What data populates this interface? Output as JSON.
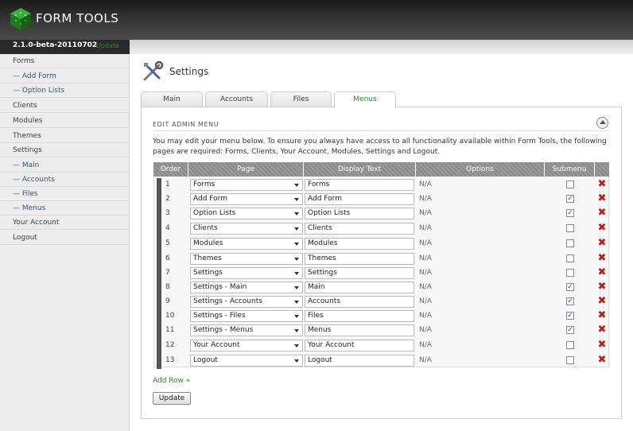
{
  "app": {
    "title": "FORM TOOLS",
    "version": "2.1.0-beta-20110702",
    "update_label": "Update"
  },
  "sidebar": {
    "items": [
      {
        "label": "Forms"
      },
      {
        "label": "— Add Form"
      },
      {
        "label": "— Option Lists"
      },
      {
        "label": "Clients"
      },
      {
        "label": "Modules"
      },
      {
        "label": "Themes"
      },
      {
        "label": "Settings"
      },
      {
        "label": "— Main"
      },
      {
        "label": "— Accounts"
      },
      {
        "label": "— Files"
      },
      {
        "label": "— Menus"
      },
      {
        "label": "Your Account"
      },
      {
        "label": "Logout"
      }
    ]
  },
  "page": {
    "title": "Settings",
    "tabs": [
      {
        "label": "Main"
      },
      {
        "label": "Accounts"
      },
      {
        "label": "Files"
      },
      {
        "label": "Menus"
      }
    ],
    "active_tab": "Menus",
    "section_title": "EDIT ADMIN MENU",
    "intro": "You may edit your menu below. To ensure you always have access to all functionality available within Form Tools, the following pages are required: Forms, Clients, Your Account, Modules, Settings and Logout."
  },
  "table": {
    "headers": {
      "order": "Order",
      "page": "Page",
      "display": "Display Text",
      "options": "Options",
      "submenu": "Submenu"
    },
    "rows": [
      {
        "order": "1",
        "page": "Forms",
        "display": "Forms",
        "options": "N/A",
        "submenu": false
      },
      {
        "order": "2",
        "page": "Add Form",
        "display": "Add Form",
        "options": "N/A",
        "submenu": true
      },
      {
        "order": "3",
        "page": "Option Lists",
        "display": "Option Lists",
        "options": "N/A",
        "submenu": true
      },
      {
        "order": "4",
        "page": "Clients",
        "display": "Clients",
        "options": "N/A",
        "submenu": false
      },
      {
        "order": "5",
        "page": "Modules",
        "display": "Modules",
        "options": "N/A",
        "submenu": false
      },
      {
        "order": "6",
        "page": "Themes",
        "display": "Themes",
        "options": "N/A",
        "submenu": false
      },
      {
        "order": "7",
        "page": "Settings",
        "display": "Settings",
        "options": "N/A",
        "submenu": false
      },
      {
        "order": "8",
        "page": "Settings - Main",
        "display": "Main",
        "options": "N/A",
        "submenu": true
      },
      {
        "order": "9",
        "page": "Settings - Accounts",
        "display": "Accounts",
        "options": "N/A",
        "submenu": true
      },
      {
        "order": "10",
        "page": "Settings - Files",
        "display": "Files",
        "options": "N/A",
        "submenu": true
      },
      {
        "order": "11",
        "page": "Settings - Menus",
        "display": "Menus",
        "options": "N/A",
        "submenu": true
      },
      {
        "order": "12",
        "page": "Your Account",
        "display": "Your Account",
        "options": "N/A",
        "submenu": false
      },
      {
        "order": "13",
        "page": "Logout",
        "display": "Logout",
        "options": "N/A",
        "submenu": false
      }
    ]
  },
  "actions": {
    "add_row": "Add Row »",
    "update": "Update"
  },
  "colors": {
    "accent_green": "#2d8a2d",
    "link_blue": "#2f5a8a",
    "delete_red": "#c21a1a",
    "header_dark": "#2a2a2a"
  }
}
